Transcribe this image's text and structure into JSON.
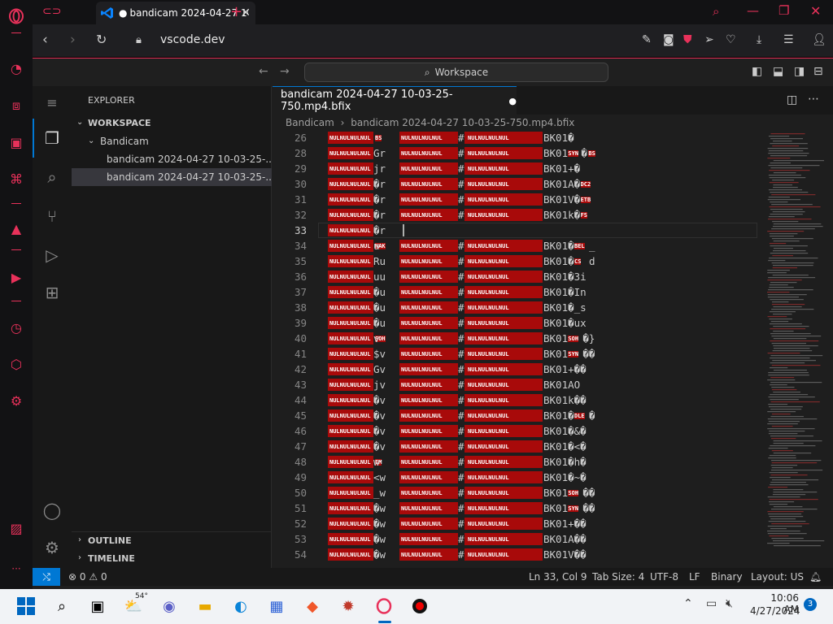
{
  "browser": {
    "tab_title": "bandicam 2024-04-27 10",
    "url": "vscode.dev",
    "new_tab_symbol": "+",
    "colors": {
      "accent": "#e8315a",
      "frame": "#121214"
    }
  },
  "vscode": {
    "command_center": "Workspace",
    "explorer_title": "EXPLORER",
    "workspace_label": "WORKSPACE",
    "folder": "Bandicam",
    "files": [
      "bandicam 2024-04-27 10-03-25-...",
      "bandicam 2024-04-27 10-03-25-..."
    ],
    "outline_label": "OUTLINE",
    "timeline_label": "TIMELINE",
    "editor_tab": "bandicam 2024-04-27 10-03-25-750.mp4.bfix",
    "breadcrumb": [
      "Bandicam",
      "bandicam 2024-04-27 10-03-25-750.mp4.bfix"
    ],
    "lines": [
      {
        "n": "26",
        "a": "BS",
        "b": "",
        "c": "BK01�"
      },
      {
        "n": "28",
        "a": "",
        "b": "Gr",
        "c": "BK01",
        "d": "SYN",
        "e": "�",
        "f": "BS"
      },
      {
        "n": "29",
        "a": "",
        "b": "jr",
        "c": "BK01+�"
      },
      {
        "n": "30",
        "a": "",
        "b": "�r",
        "c": "BK01A�",
        "f": "DC2"
      },
      {
        "n": "31",
        "a": "",
        "b": "�r",
        "c": "BK01V�",
        "f": "ETB"
      },
      {
        "n": "32",
        "a": "",
        "b": "�r",
        "c": "BK01k�",
        "f": "FS"
      },
      {
        "n": "33",
        "a": "",
        "b": "�r",
        "c": ""
      },
      {
        "n": "34",
        "a": "NAK",
        "b": "u",
        "c": "BK01�",
        "f": "BEL",
        "g": "_"
      },
      {
        "n": "35",
        "a": "",
        "b": "Ru",
        "c": "BK01�",
        "f": "CS",
        "g": "d"
      },
      {
        "n": "36",
        "a": "",
        "b": "uu",
        "c": "BK01�3i"
      },
      {
        "n": "37",
        "a": "",
        "b": "�u",
        "c": "BK01�In"
      },
      {
        "n": "38",
        "a": "",
        "b": "�u",
        "c": "BK01�_s"
      },
      {
        "n": "39",
        "a": "",
        "b": "�u",
        "c": "BK01�ux"
      },
      {
        "n": "40",
        "a": "SOH",
        "b": "v",
        "c": "BK01",
        "f": "SOH",
        "g": "�}"
      },
      {
        "n": "41",
        "a": "",
        "b": "$v",
        "c": "BK01",
        "f": "SYN",
        "g": "��"
      },
      {
        "n": "42",
        "a": "",
        "b": "Gv",
        "c": "BK01+��"
      },
      {
        "n": "43",
        "a": "",
        "b": "jv",
        "c": "BK01AO"
      },
      {
        "n": "44",
        "a": "",
        "b": "�v",
        "c": "BK01k��"
      },
      {
        "n": "45",
        "a": "",
        "b": "�v",
        "c": "BK01�",
        "f": "DLE",
        "g": "�"
      },
      {
        "n": "46",
        "a": "",
        "b": "�v",
        "c": "BK01�&�"
      },
      {
        "n": "47",
        "a": "",
        "b": "�v",
        "c": "BK01�<�"
      },
      {
        "n": "48",
        "a": "EM",
        "b": "w",
        "c": "BK01�h�"
      },
      {
        "n": "49",
        "a": "",
        "b": "<w",
        "c": "BK01�~�"
      },
      {
        "n": "50",
        "a": "",
        "b": "_w",
        "c": "BK01",
        "f": "SOH",
        "g": "��"
      },
      {
        "n": "51",
        "a": "",
        "b": "�w",
        "c": "BK01",
        "f": "SYN",
        "g": "��"
      },
      {
        "n": "52",
        "a": "",
        "b": "�w",
        "c": "BK01+��"
      },
      {
        "n": "53",
        "a": "",
        "b": "�w",
        "c": "BK01A��"
      },
      {
        "n": "54",
        "a": "",
        "b": "�w",
        "c": "BK01V��"
      }
    ],
    "null_label": "NULNULNULNUL",
    "status": {
      "errors": "0",
      "warnings": "0",
      "position": "Ln 33, Col 9",
      "tab_size": "Tab Size: 4",
      "encoding": "UTF-8",
      "eol": "LF",
      "language": "Binary",
      "layout": "Layout: US"
    }
  },
  "taskbar": {
    "weather": "54°",
    "time": "10:06 AM",
    "date": "4/27/2024",
    "notifications": "3"
  }
}
